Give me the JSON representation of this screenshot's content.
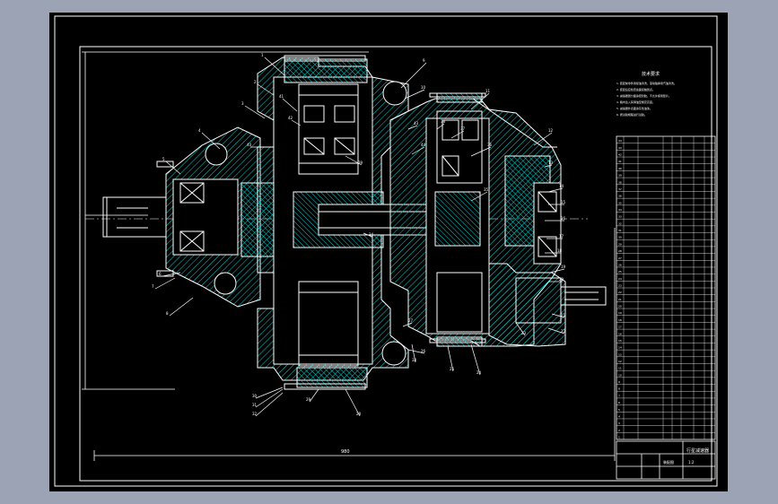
{
  "colors": {
    "background": "#9ba3b5",
    "sheet": "#000000",
    "lines": "#ffffff",
    "hatch": "#00d0d0",
    "leader": "#ffffff"
  },
  "drawing": {
    "notes_title": "技术要求",
    "notes": [
      "1. 装配前零件用煤油清洗，滚动轴承用汽油清洗。",
      "2. 装配后应检查齿面接触斑点。",
      "3. 减速器剖分面涂密封胶，不允许使用垫片。",
      "4. 箱内注入润滑油至规定高度。",
      "5. 减速器外表面涂灰色油漆。",
      "6. 按试验规程进行试验。"
    ],
    "part_labels": [
      "1",
      "2",
      "3",
      "4",
      "5",
      "6",
      "7",
      "8",
      "9",
      "10",
      "11",
      "12",
      "13",
      "14",
      "15",
      "16",
      "17",
      "18",
      "19",
      "20",
      "21",
      "22",
      "23",
      "24",
      "25",
      "26",
      "27",
      "28",
      "29",
      "30",
      "31",
      "32",
      "33",
      "34",
      "35",
      "36",
      "37",
      "38",
      "39",
      "40",
      "41",
      "42",
      "43",
      "44"
    ],
    "overall_dimension": "980",
    "title_block": {
      "title": "行星减速器",
      "scale": "1:2",
      "sheet": "装配图"
    },
    "bom_rows": 44
  }
}
